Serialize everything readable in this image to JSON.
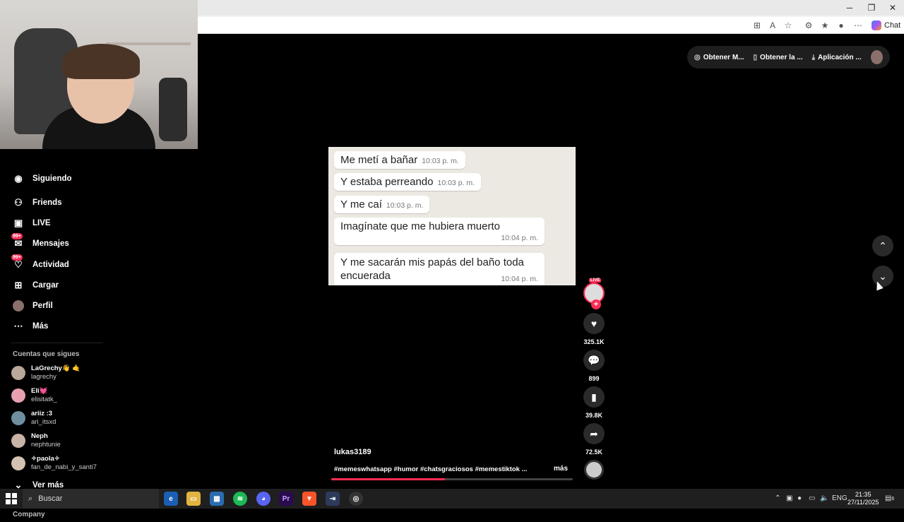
{
  "browser": {
    "chat_label": "Chat",
    "window_buttons": {
      "minimize": "─",
      "restore": "❐",
      "close": "✕"
    }
  },
  "top_actions": {
    "items": [
      {
        "label": "Obtener M...",
        "icon": "circle-check-icon"
      },
      {
        "label": "Obtener la ...",
        "icon": "phone-icon"
      },
      {
        "label": "Aplicación ...",
        "icon": "download-icon"
      }
    ]
  },
  "sidebar": {
    "partial_top": "Siguiendo",
    "items": [
      {
        "label": "Friends",
        "icon": "friends-icon"
      },
      {
        "label": "LIVE",
        "icon": "live-icon"
      },
      {
        "label": "Mensajes",
        "icon": "messages-icon",
        "badge": "99+"
      },
      {
        "label": "Actividad",
        "icon": "activity-icon",
        "badge": "99+"
      },
      {
        "label": "Cargar",
        "icon": "upload-icon"
      },
      {
        "label": "Perfil",
        "icon": "profile-avatar"
      },
      {
        "label": "Más",
        "icon": "more-icon"
      }
    ],
    "following_title": "Cuentas que sigues",
    "accounts": [
      {
        "name": "LaGrechy👋 🤙",
        "handle": "lagrechy"
      },
      {
        "name": "Eli💓",
        "handle": "elisitatk_"
      },
      {
        "name": "ariiz :3",
        "handle": "ari_itsxd"
      },
      {
        "name": "Neph",
        "handle": "nephtunie"
      },
      {
        "name": "✧paola✧",
        "handle": "fan_de_nabi_y_santi7"
      }
    ],
    "see_more": "Ver más",
    "company": "Company"
  },
  "video": {
    "messages": [
      {
        "text": "Me metí a bañar",
        "time": "10:03 p. m."
      },
      {
        "text": "Y estaba perreando",
        "time": "10:03 p. m."
      },
      {
        "text": "Y me caí",
        "time": "10:03 p. m."
      },
      {
        "text": "Imagínate que me hubiera muerto",
        "time": "10:04 p. m."
      },
      {
        "text": "Y me sacarán mis papás del baño toda encuerada",
        "time": "10:04 p. m."
      }
    ],
    "progress": 0.47
  },
  "rail": {
    "live_tag": "LIVE",
    "likes": "325.1K",
    "comments": "899",
    "saves": "39.8K",
    "shares": "72.5K"
  },
  "post": {
    "username": "lukas3189",
    "hashtags": "#memeswhatsapp #humor #chatsgraciosos #memestiktok ...",
    "more": "más"
  },
  "taskbar": {
    "search_label": "Buscar",
    "lang": "ENG",
    "time": "21:35",
    "date": "27/11/2025",
    "notifications": "6"
  }
}
